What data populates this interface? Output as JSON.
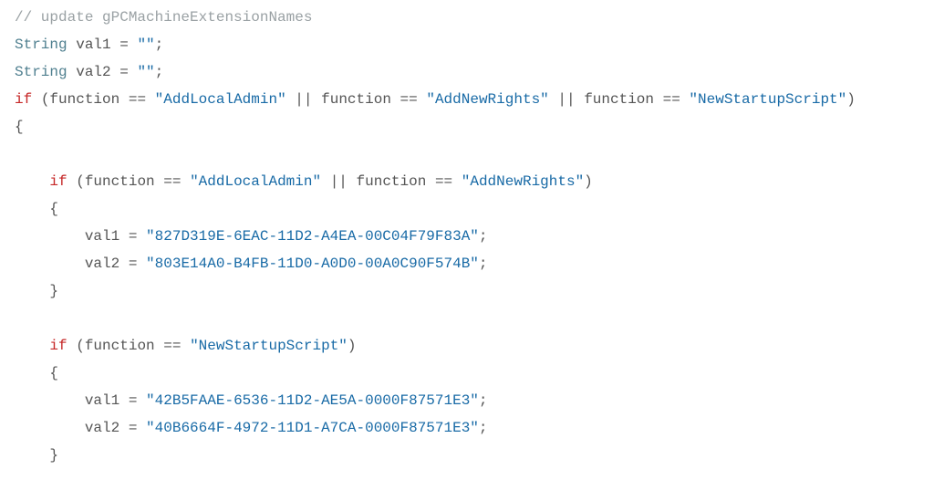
{
  "code": {
    "comment": "// update gPCMachineExtensionNames",
    "decl1": {
      "type": "String",
      "name": "val1",
      "eq": "=",
      "val": "\"\"",
      "semi": ";"
    },
    "decl2": {
      "type": "String",
      "name": "val2",
      "eq": "=",
      "val": "\"\"",
      "semi": ";"
    },
    "if1": {
      "kwIf": "if",
      "lpar": "(",
      "var": "function",
      "eqeq": "==",
      "lit1": "\"AddLocalAdmin\"",
      "or": "||",
      "lit2": "\"AddNewRights\"",
      "lit3": "\"NewStartupScript\"",
      "rpar": ")"
    },
    "lbrace": "{",
    "rbrace": "}",
    "inner1": {
      "lit1": "\"AddLocalAdmin\"",
      "lit2": "\"AddNewRights\"",
      "a1": {
        "name": "val1",
        "eq": "=",
        "val": "\"827D319E-6EAC-11D2-A4EA-00C04F79F83A\"",
        "semi": ";"
      },
      "a2": {
        "name": "val2",
        "eq": "=",
        "val": "\"803E14A0-B4FB-11D0-A0D0-00A0C90F574B\"",
        "semi": ";"
      }
    },
    "inner2": {
      "lit": "\"NewStartupScript\"",
      "a1": {
        "name": "val1",
        "eq": "=",
        "val": "\"42B5FAAE-6536-11D2-AE5A-0000F87571E3\"",
        "semi": ";"
      },
      "a2": {
        "name": "val2",
        "eq": "=",
        "val": "\"40B6664F-4972-11D1-A7CA-0000F87571E3\"",
        "semi": ";"
      }
    }
  }
}
